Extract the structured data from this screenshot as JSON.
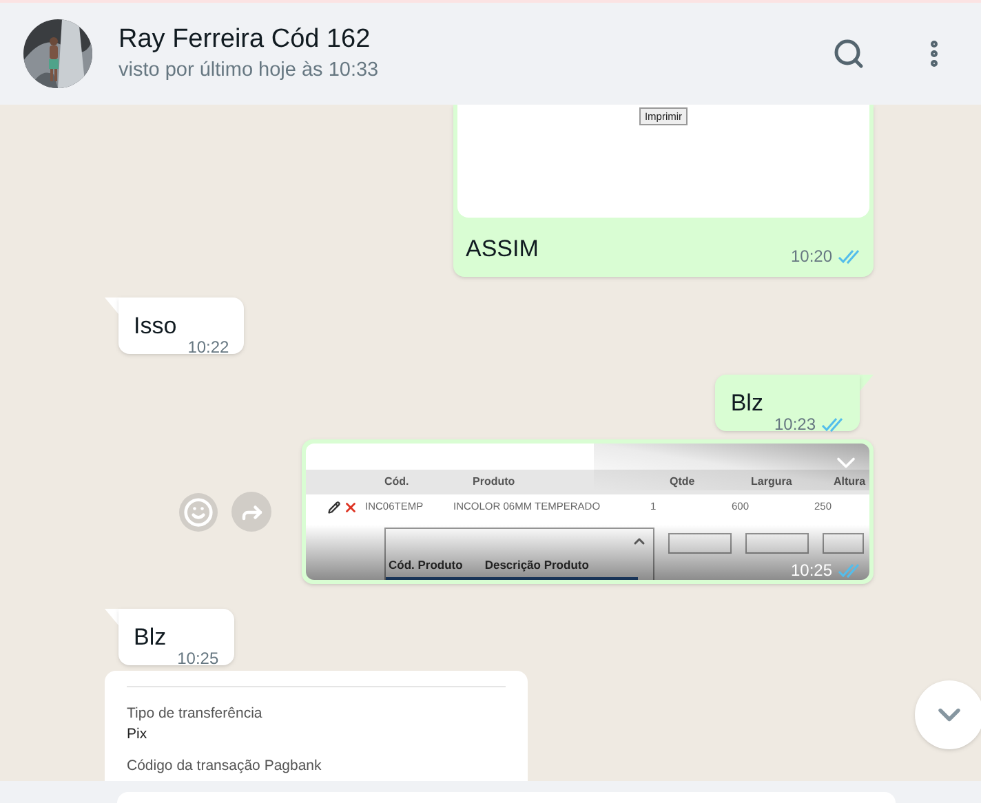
{
  "header": {
    "name": "Ray Ferreira Cód 162",
    "status": "visto por último hoje às 10:33"
  },
  "messages": [
    {
      "kind": "image_caption",
      "outgoing": true,
      "tail": false,
      "button": "Imprimir",
      "text": "ASSIM",
      "time": "10:20",
      "read": true
    },
    {
      "kind": "text",
      "outgoing": false,
      "tail": true,
      "text": "Isso",
      "time": "10:22"
    },
    {
      "kind": "text",
      "outgoing": true,
      "tail": true,
      "text": "Blz",
      "time": "10:23",
      "read": true
    },
    {
      "kind": "screenshot",
      "outgoing": true,
      "columns": [
        "Cód.",
        "Produto",
        "Qtde",
        "Largura",
        "Altura"
      ],
      "row": [
        "INC06TEMP",
        "INCOLOR 06MM TEMPERADO",
        "1",
        "600",
        "250"
      ],
      "dropdown_columns": [
        "Cód. Produto",
        "Descrição Produto"
      ],
      "time": "10:25",
      "read": true
    },
    {
      "kind": "text",
      "outgoing": false,
      "tail": true,
      "text": "Blz",
      "time": "10:25"
    },
    {
      "kind": "receipt",
      "outgoing": false,
      "fields": [
        {
          "label": "Tipo de transferência",
          "value": "Pix"
        },
        {
          "label": "Código da transação Pagbank"
        }
      ]
    }
  ]
}
